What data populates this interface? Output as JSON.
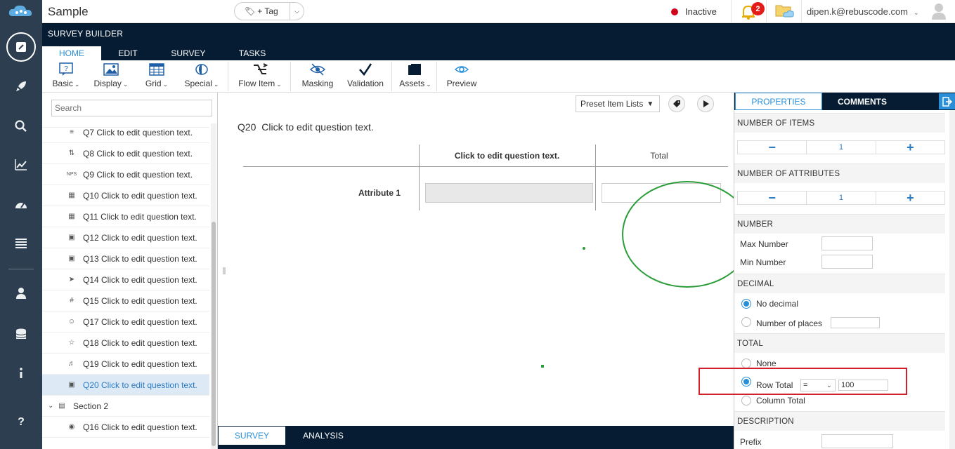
{
  "app": {
    "title": "Sample",
    "tag_label": "+ Tag",
    "status": "Inactive",
    "notification_count": "2",
    "user_email": "dipen.k@rebuscode.com"
  },
  "ribbon": {
    "section_title": "SURVEY BUILDER",
    "tabs": [
      "HOME",
      "EDIT",
      "SURVEY",
      "TASKS"
    ],
    "tools": {
      "basic": "Basic",
      "display": "Display",
      "grid": "Grid",
      "special": "Special",
      "flow_item": "Flow Item",
      "masking": "Masking",
      "validation": "Validation",
      "assets": "Assets",
      "preview": "Preview"
    }
  },
  "sidebar": {
    "search_placeholder": "Search",
    "items": [
      {
        "label": "Q7 Click to edit question text.",
        "icon": "sort-icon"
      },
      {
        "label": "Q8 Click to edit question text.",
        "icon": "sliders-icon"
      },
      {
        "label": "Q9 Click to edit question text.",
        "icon": "nps-icon",
        "icon_text": "NPS"
      },
      {
        "label": "Q10 Click to edit question text.",
        "icon": "grid-icon"
      },
      {
        "label": "Q11 Click to edit question text.",
        "icon": "grid-icon"
      },
      {
        "label": "Q12 Click to edit question text.",
        "icon": "numeric-icon"
      },
      {
        "label": "Q13 Click to edit question text.",
        "icon": "numeric-icon"
      },
      {
        "label": "Q14 Click to edit question text.",
        "icon": "send-icon"
      },
      {
        "label": "Q15 Click to edit question text.",
        "icon": "hash-icon"
      },
      {
        "label": "Q17 Click to edit question text.",
        "icon": "smiley-icon"
      },
      {
        "label": "Q18 Click to edit question text.",
        "icon": "star-icon"
      },
      {
        "label": "Q19 Click to edit question text.",
        "icon": "audio-icon"
      },
      {
        "label": "Q20 Click to edit question text.",
        "icon": "numeric-icon",
        "selected": true
      }
    ],
    "section2": {
      "label": "Section 2",
      "item": "Q16 Click to edit question text."
    }
  },
  "canvas": {
    "preset_label": "Preset Item Lists",
    "question_number": "Q20",
    "question_text": "Click to edit question text.",
    "column_header": "Click to edit question text.",
    "total_header": "Total",
    "attribute_label": "Attribute 1"
  },
  "bottom_tabs": [
    "SURVEY",
    "ANALYSIS"
  ],
  "properties": {
    "tabs": [
      "PROPERTIES",
      "COMMENTS"
    ],
    "number_of_items": {
      "title": "NUMBER OF ITEMS",
      "value": "1"
    },
    "number_of_attributes": {
      "title": "NUMBER OF ATTRIBUTES",
      "value": "1"
    },
    "number": {
      "title": "NUMBER",
      "max_label": "Max Number",
      "min_label": "Min Number",
      "max_value": "",
      "min_value": ""
    },
    "decimal": {
      "title": "DECIMAL",
      "no_decimal": "No decimal",
      "number_of_places": "Number of places",
      "selected": "No decimal"
    },
    "total": {
      "title": "TOTAL",
      "none": "None",
      "row_total": "Row Total",
      "column_total": "Column Total",
      "selected": "Row Total",
      "operator": "=",
      "value": "100"
    },
    "description": {
      "title": "DESCRIPTION",
      "prefix_label": "Prefix"
    }
  },
  "colors": {
    "nav_bg": "#2c3e50",
    "header_bg": "#061c33",
    "accent": "#2a8fd6",
    "annotation_green": "#2a9d3a",
    "annotation_red": "#d0202a",
    "status_red": "#d0021b"
  }
}
